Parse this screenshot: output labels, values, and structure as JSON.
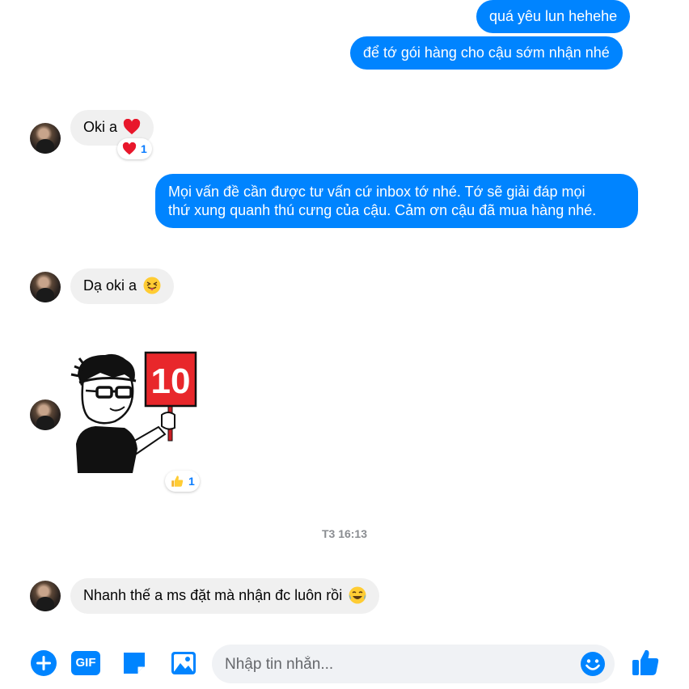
{
  "messages": {
    "m1": "quá yêu lun hehehe",
    "m2": "để tớ gói hàng cho cậu sớm nhận nhé",
    "m3": "Oki a",
    "m3_reaction_count": "1",
    "m4_line1": "Mọi vấn đề cần được tư vấn cứ inbox tớ nhé. Tớ sẽ giải đáp mọi",
    "m4_line2": "thứ xung quanh thú cưng của cậu. Cảm ơn cậu đã mua hàng nhé.",
    "m5": "Dạ oki a",
    "sticker_sign": "10",
    "sticker_reaction_count": "1",
    "m6": "Nhanh thế a ms đặt mà nhận đc luôn rồi"
  },
  "timestamp": "T3 16:13",
  "composer": {
    "placeholder": "Nhập tin nhắn...",
    "gif_label": "GIF"
  },
  "icons": {
    "reaction_m3": "heart-icon",
    "reaction_sticker": "thumbs-up-icon",
    "toolbar": [
      "plus-circle-icon",
      "gif-icon",
      "sticker-icon",
      "image-icon",
      "emoji-icon",
      "like-icon"
    ]
  },
  "colors": {
    "accent": "#0084ff",
    "incoming_bubble": "#f0f0f0",
    "heart": "#e8172b",
    "sign_red": "#e8272b"
  }
}
